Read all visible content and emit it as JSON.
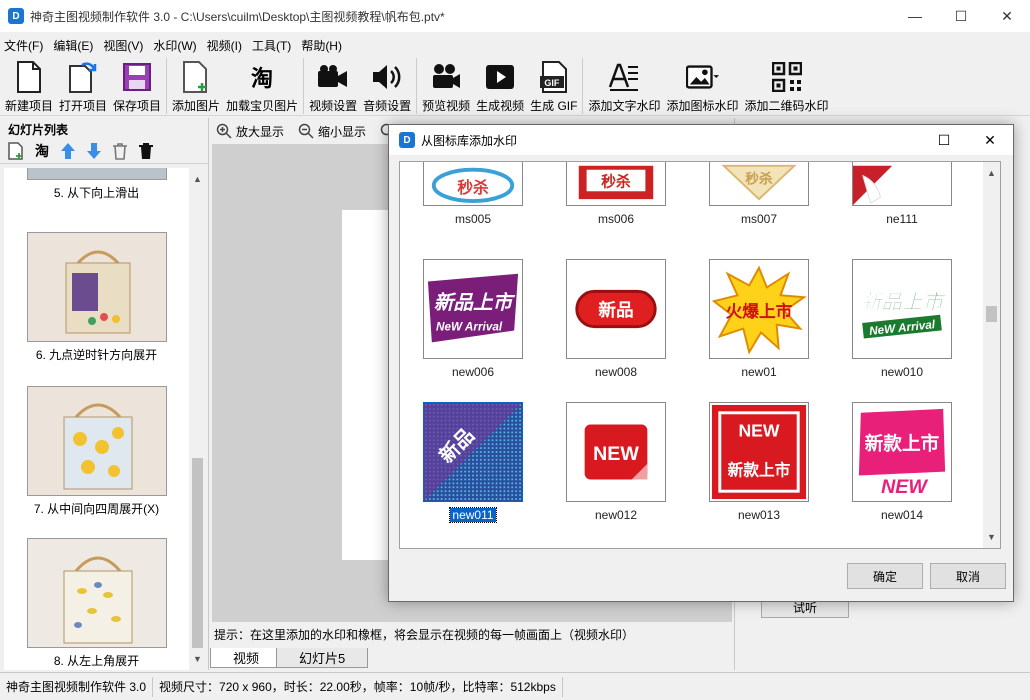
{
  "window": {
    "title": "神奇主图视频制作软件 3.0 - C:\\Users\\cuilm\\Desktop\\主图视频教程\\帆布包.ptv*",
    "minimize": "—",
    "maximize": "☐",
    "close": "✕"
  },
  "menu": [
    "文件(F)",
    "编辑(E)",
    "视图(V)",
    "水印(W)",
    "视频(I)",
    "工具(T)",
    "帮助(H)"
  ],
  "toolbar": {
    "new_project": "新建项目",
    "open_project": "打开项目",
    "save_project": "保存项目",
    "add_image": "添加图片",
    "load_taobao": "加载宝贝图片",
    "video_settings": "视频设置",
    "audio_settings": "音频设置",
    "preview_video": "预览视频",
    "generate_video": "生成视频",
    "generate_gif": "生成 GIF",
    "add_text_watermark": "添加文字水印",
    "add_icon_watermark": "添加图标水印",
    "add_qr_watermark": "添加二维码水印",
    "taobao_glyph": "淘",
    "gif_glyph": "GIF"
  },
  "slides_panel": {
    "title": "幻灯片列表",
    "taobao_glyph": "淘",
    "items": [
      {
        "label": "5. 从下向上滑出"
      },
      {
        "label": "6. 九点逆时针方向展开"
      },
      {
        "label": "7. 从中间向四周展开(X)"
      },
      {
        "label": "8. 从左上角展开"
      }
    ]
  },
  "editor": {
    "zoom_in": "放大显示",
    "zoom_out": "缩小显示",
    "hint": "提示：在这里添加的水印和橡框，将会显示在视频的每一帧画面上（视频水印）",
    "tabs": [
      "视频",
      "幻灯片5"
    ]
  },
  "right_panel": {
    "listen_button": "试听"
  },
  "status": {
    "app": "神奇主图视频制作软件 3.0",
    "info": "视频尺寸：720 x 960，时长：22.00秒，帧率：10帧/秒，比特率：512kbps"
  },
  "dialog": {
    "title": "从图标库添加水印",
    "maximize": "☐",
    "close": "✕",
    "ok": "确定",
    "cancel": "取消",
    "items": [
      {
        "name": "ms005",
        "art": "秒杀"
      },
      {
        "name": "ms006",
        "art": "秒杀"
      },
      {
        "name": "ms007",
        "art": "秒杀"
      },
      {
        "name": "ne111",
        "art": ""
      },
      {
        "name": "new006",
        "art": "新品上市",
        "art_sub": "NeW Arrival"
      },
      {
        "name": "new008",
        "art": "新品"
      },
      {
        "name": "new01",
        "art": "火爆上市"
      },
      {
        "name": "new010",
        "art": "新品上市",
        "art_sub": "NeW Arrival"
      },
      {
        "name": "new011",
        "art": "新品"
      },
      {
        "name": "new012",
        "art": "NEW"
      },
      {
        "name": "new013",
        "art": "NEW",
        "art_sub": "新款上市"
      },
      {
        "name": "new014",
        "art": "新款上市",
        "art_sub": "NEW"
      }
    ],
    "selected": "new011"
  }
}
